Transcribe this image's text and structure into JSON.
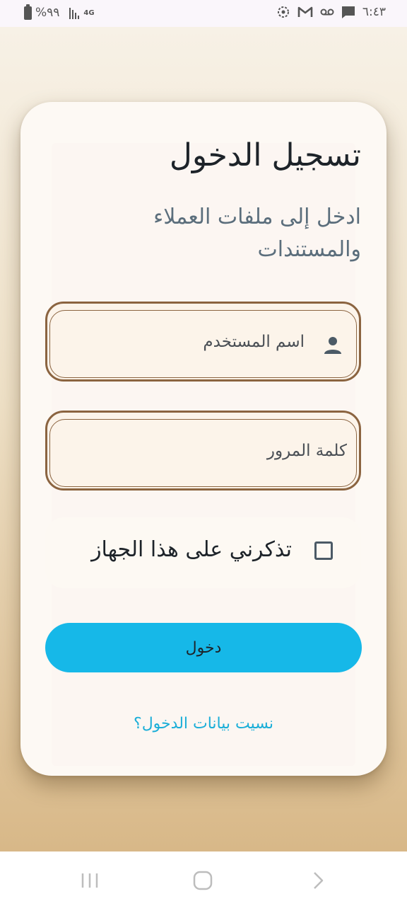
{
  "status_bar": {
    "time": "٦:٤٣",
    "battery": "%٩٩",
    "network": "4G",
    "icons": [
      "chat-bubble-icon",
      "voicemail-icon",
      "gmail-icon",
      "sync-icon"
    ]
  },
  "login": {
    "title": "تسجيل الدخول",
    "subtitle": "ادخل إلى ملفات العملاء والمستندات",
    "username": {
      "placeholder": "اسم المستخدم",
      "value": "",
      "icon": "user-icon"
    },
    "password": {
      "placeholder": "كلمة المرور",
      "value": ""
    },
    "remember_label": "تذكرني على هذا الجهاز",
    "remember_checked": false,
    "login_button": "دخول",
    "forgot_link": "نسيت بيانات الدخول؟"
  },
  "nav_bar": {
    "buttons": [
      "recent-apps-icon",
      "home-icon",
      "back-icon"
    ]
  },
  "colors": {
    "accent": "#16b8e8",
    "field_border": "#8b6440",
    "link": "#1aaed8",
    "title": "#1d2329",
    "subtitle": "#5b6e7c"
  }
}
